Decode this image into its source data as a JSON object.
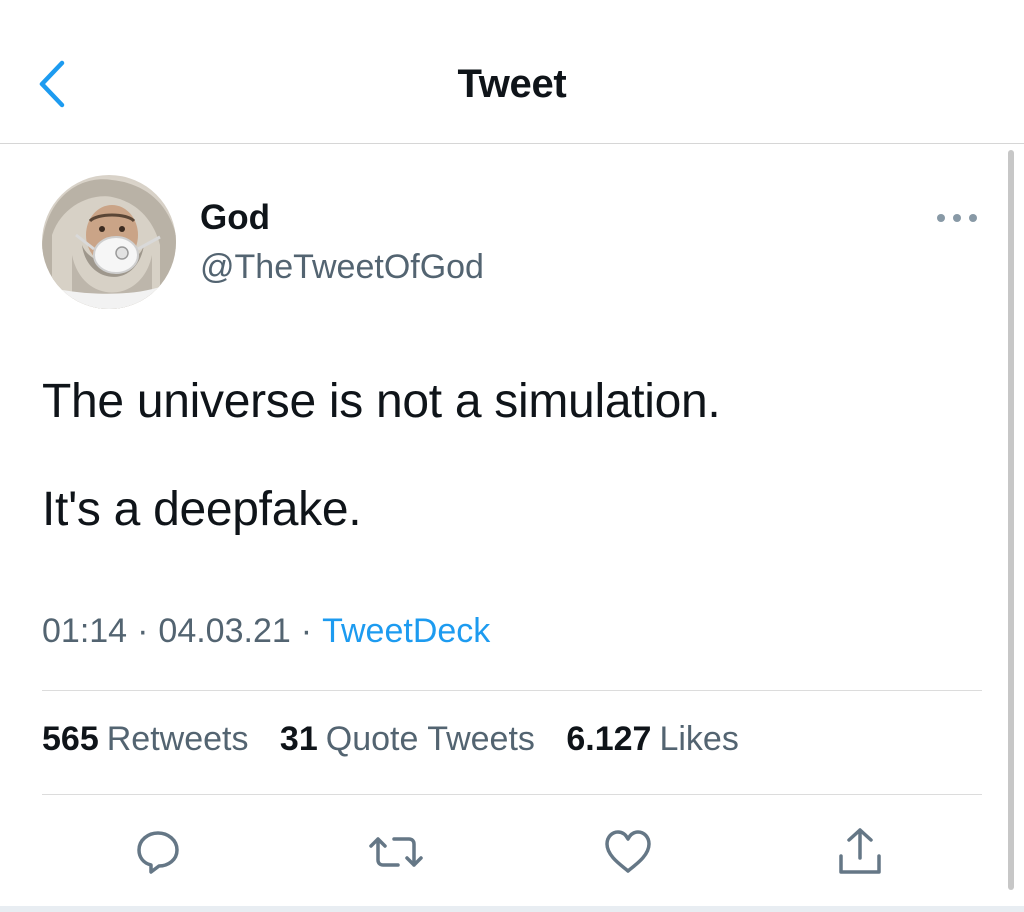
{
  "header": {
    "title": "Tweet",
    "back_icon": "chevron-left-icon"
  },
  "author": {
    "name": "God",
    "handle": "@TheTweetOfGod"
  },
  "tweet": {
    "lines": [
      "The universe is not a simulation.",
      "It's a deepfake."
    ]
  },
  "meta": {
    "time": "01:14",
    "date": "04.03.21",
    "source": "TweetDeck",
    "separator": "·"
  },
  "stats": {
    "retweets": {
      "count": "565",
      "label": "Retweets"
    },
    "quotes": {
      "count": "31",
      "label": "Quote Tweets"
    },
    "likes": {
      "count": "6.127",
      "label": "Likes"
    }
  },
  "actions": [
    "reply-icon",
    "retweet-icon",
    "like-icon",
    "share-icon"
  ],
  "colors": {
    "accent": "#1d9bf0",
    "muted": "#536471",
    "text": "#0f1419",
    "divider": "#dcdcdc"
  }
}
